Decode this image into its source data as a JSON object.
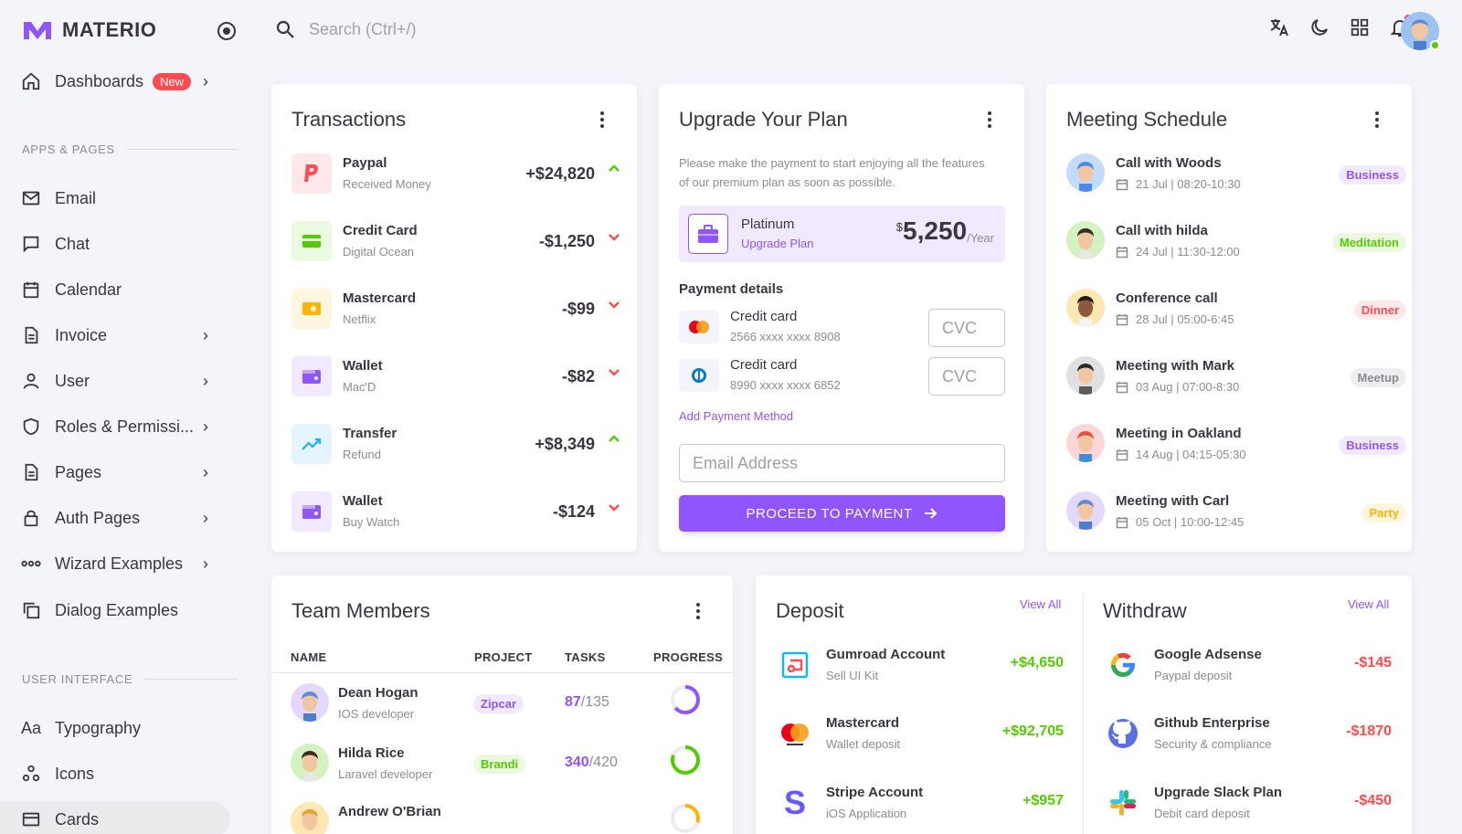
{
  "brand": {
    "name": "MATERIO"
  },
  "search": {
    "placeholder": "Search (Ctrl+/)"
  },
  "sidebar": {
    "dashboards": {
      "label": "Dashboards",
      "badge": "New"
    },
    "section_apps": "APPS & PAGES",
    "items": [
      {
        "label": "Email",
        "icon": "mail-icon"
      },
      {
        "label": "Chat",
        "icon": "chat-icon"
      },
      {
        "label": "Calendar",
        "icon": "calendar-icon"
      },
      {
        "label": "Invoice",
        "icon": "file-icon"
      },
      {
        "label": "User",
        "icon": "user-icon"
      },
      {
        "label": "Roles & Permissi...",
        "icon": "shield-icon"
      },
      {
        "label": "Pages",
        "icon": "file-icon"
      },
      {
        "label": "Auth Pages",
        "icon": "lock-icon"
      },
      {
        "label": "Wizard Examples",
        "icon": "dots-icon"
      },
      {
        "label": "Dialog Examples",
        "icon": "copy-icon"
      }
    ],
    "section_ui": "USER INTERFACE",
    "ui_items": [
      {
        "label": "Typography",
        "icon": "typography-icon"
      },
      {
        "label": "Icons",
        "icon": "icons-icon"
      },
      {
        "label": "Cards",
        "icon": "card-icon"
      }
    ]
  },
  "transactions": {
    "title": "Transactions",
    "rows": [
      {
        "name": "Paypal",
        "sub": "Received Money",
        "amount": "+$24,820",
        "dir": "up"
      },
      {
        "name": "Credit Card",
        "sub": "Digital Ocean",
        "amount": "-$1,250",
        "dir": "down"
      },
      {
        "name": "Mastercard",
        "sub": "Netflix",
        "amount": "-$99",
        "dir": "down"
      },
      {
        "name": "Wallet",
        "sub": "Mac'D",
        "amount": "-$82",
        "dir": "down"
      },
      {
        "name": "Transfer",
        "sub": "Refund",
        "amount": "+$8,349",
        "dir": "up"
      },
      {
        "name": "Wallet",
        "sub": "Buy Watch",
        "amount": "-$124",
        "dir": "down"
      }
    ]
  },
  "upgrade": {
    "title": "Upgrade Your Plan",
    "desc": "Please make the payment to start enjoying all the features of our premium plan as soon as possible.",
    "plan_name": "Platinum",
    "plan_link": "Upgrade Plan",
    "currency": "$",
    "price": "5,250",
    "period": "/Year",
    "payment_title": "Payment details",
    "cards": [
      {
        "name": "Credit card",
        "number": "2566 xxxx xxxx 8908",
        "cvc_placeholder": "CVC"
      },
      {
        "name": "Credit card",
        "number": "8990 xxxx xxxx 6852",
        "cvc_placeholder": "CVC"
      }
    ],
    "add_method": "Add Payment Method",
    "email_placeholder": "Email Address",
    "proceed": "PROCEED TO PAYMENT"
  },
  "meetings": {
    "title": "Meeting Schedule",
    "rows": [
      {
        "name": "Call with Woods",
        "date": "21 Jul | 08:20-10:30",
        "tag": "Business",
        "tag_color": "#9155fd",
        "tag_bg": "#f1eaff"
      },
      {
        "name": "Call with hilda",
        "date": "24 Jul | 11:30-12:00",
        "tag": "Meditation",
        "tag_color": "#56ca00",
        "tag_bg": "#ebf9e0"
      },
      {
        "name": "Conference call",
        "date": "28 Jul | 05:00-6:45",
        "tag": "Dinner",
        "tag_color": "#ff4c51",
        "tag_bg": "#ffe8e9"
      },
      {
        "name": "Meeting with Mark",
        "date": "03 Aug | 07:00-8:30",
        "tag": "Meetup",
        "tag_color": "#8a8d93",
        "tag_bg": "#eeeef0"
      },
      {
        "name": "Meeting in Oakland",
        "date": "14 Aug | 04:15-05:30",
        "tag": "Business",
        "tag_color": "#9155fd",
        "tag_bg": "#f1eaff"
      },
      {
        "name": "Meeting with Carl",
        "date": "05 Oct | 10:00-12:45",
        "tag": "Party",
        "tag_color": "#ffb400",
        "tag_bg": "#fff6e0"
      }
    ]
  },
  "team": {
    "title": "Team Members",
    "headers": [
      "NAME",
      "PROJECT",
      "TASKS",
      "PROGRESS"
    ],
    "rows": [
      {
        "name": "Dean Hogan",
        "role": "IOS developer",
        "project": "Zipcar",
        "done": "87",
        "total": "/135",
        "progress": 0.64,
        "color": "#9155fd",
        "proj_color": "#9155fd",
        "proj_bg": "#f1eaff"
      },
      {
        "name": "Hilda Rice",
        "role": "Laravel developer",
        "project": "Brandi",
        "done": "340",
        "total": "/420",
        "progress": 0.81,
        "color": "#56ca00",
        "proj_color": "#56ca00",
        "proj_bg": "#ebf9e0"
      },
      {
        "name": "Andrew O'Brian",
        "role": "",
        "project": "",
        "done": "",
        "total": "",
        "progress": 0.3,
        "color": "#ffb400",
        "proj_color": "#ffb400",
        "proj_bg": "#fff6e0"
      }
    ]
  },
  "deposit": {
    "title": "Deposit",
    "view_all": "View All",
    "rows": [
      {
        "name": "Gumroad Account",
        "sub": "Sell UI Kit",
        "amount": "+$4,650"
      },
      {
        "name": "Mastercard",
        "sub": "Wallet deposit",
        "amount": "+$92,705"
      },
      {
        "name": "Stripe Account",
        "sub": "iOS Application",
        "amount": "+$957"
      }
    ]
  },
  "withdraw": {
    "title": "Withdraw",
    "view_all": "View All",
    "rows": [
      {
        "name": "Google Adsense",
        "sub": "Paypal deposit",
        "amount": "-$145"
      },
      {
        "name": "Github Enterprise",
        "sub": "Security & compliance",
        "amount": "-$1870"
      },
      {
        "name": "Upgrade Slack Plan",
        "sub": "Debit card deposit",
        "amount": "-$450"
      }
    ]
  },
  "colors": {
    "primary": "#9155fd",
    "success": "#56ca00",
    "error": "#ff4c51",
    "warning": "#ffb400",
    "info": "#16b1ff"
  }
}
